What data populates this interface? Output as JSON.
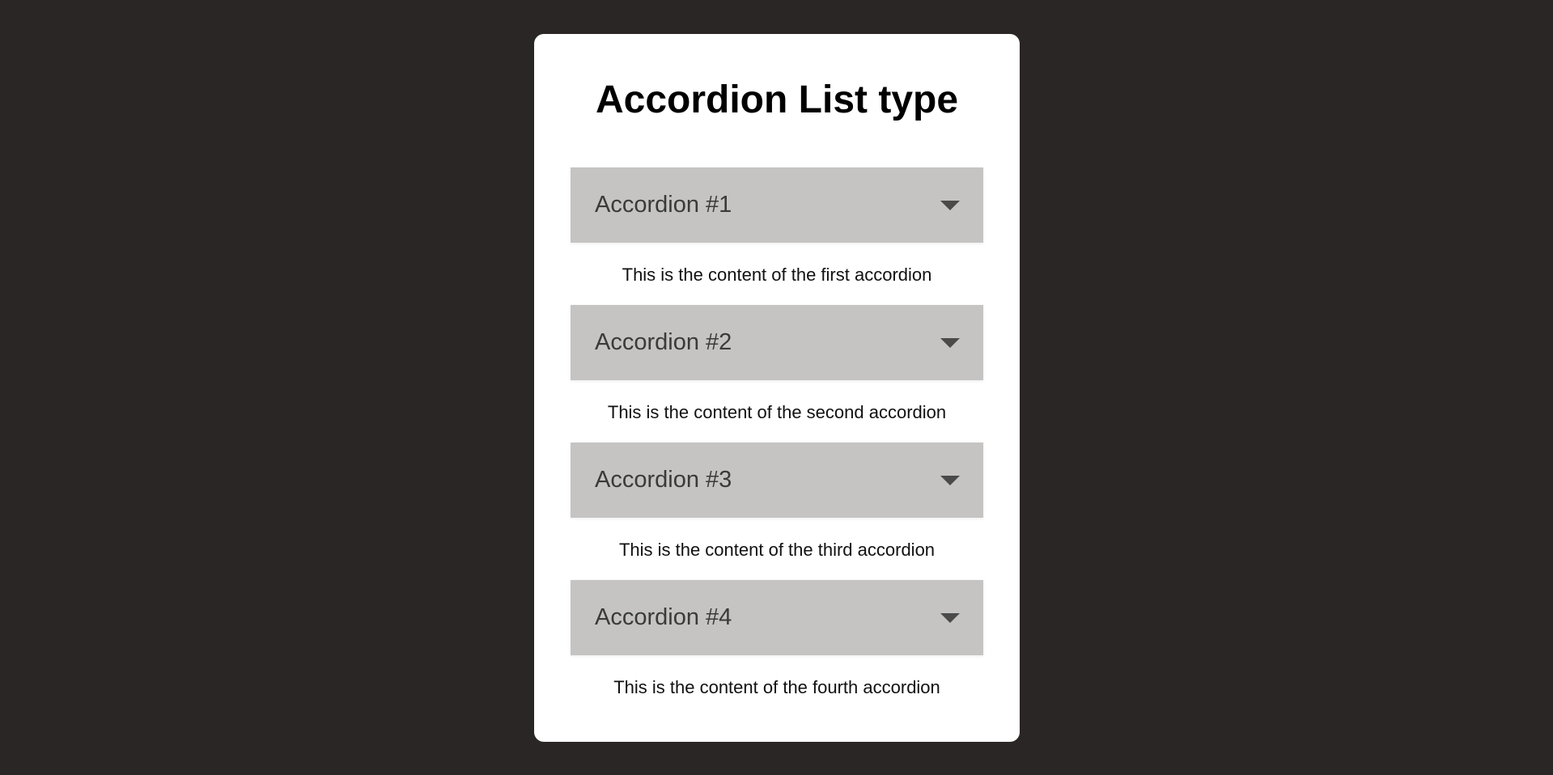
{
  "page": {
    "title": "Accordion List type"
  },
  "accordions": [
    {
      "label": "Accordion #1",
      "content": "This is the content of the first accordion",
      "icon": "caret-down-icon"
    },
    {
      "label": "Accordion #2",
      "content": "This is the content of the second accordion",
      "icon": "caret-down-icon"
    },
    {
      "label": "Accordion #3",
      "content": "This is the content of the third accordion",
      "icon": "caret-down-icon"
    },
    {
      "label": "Accordion #4",
      "content": "This is the content of the fourth accordion",
      "icon": "caret-down-icon"
    }
  ],
  "colors": {
    "background": "#292625",
    "card": "#ffffff",
    "header": "#c5c4c3",
    "icon": "#4a4a4a"
  }
}
